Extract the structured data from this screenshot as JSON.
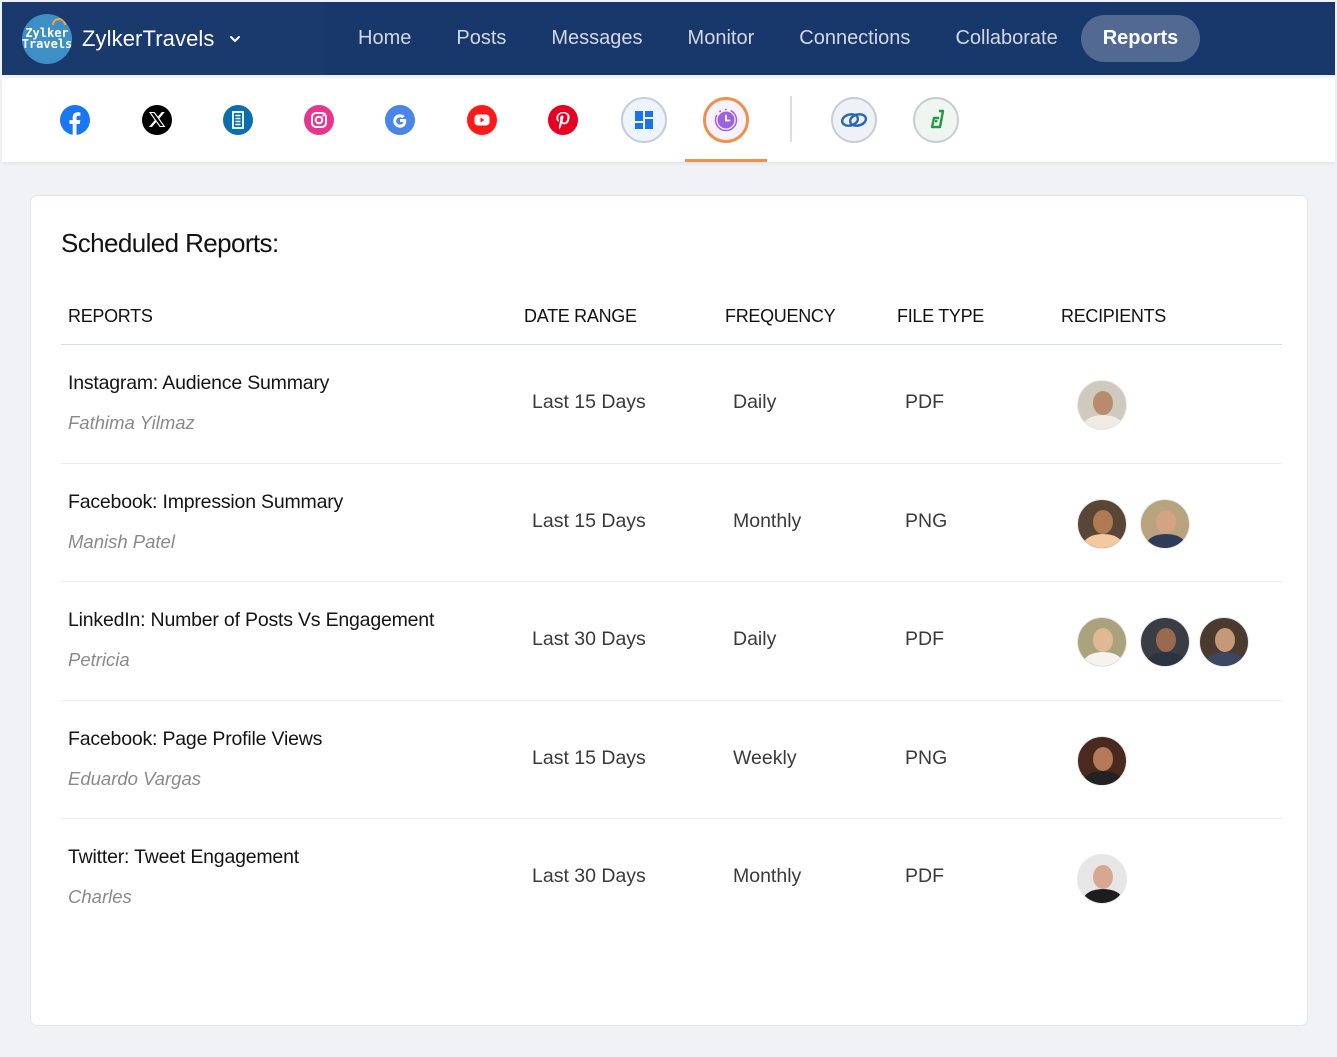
{
  "brand": {
    "name": "ZylkerTravels",
    "logo_text": [
      "Zylker",
      "Travels"
    ]
  },
  "nav": {
    "items": [
      {
        "label": "Home",
        "active": false
      },
      {
        "label": "Posts",
        "active": false
      },
      {
        "label": "Messages",
        "active": false
      },
      {
        "label": "Monitor",
        "active": false
      },
      {
        "label": "Connections",
        "active": false
      },
      {
        "label": "Collaborate",
        "active": false
      },
      {
        "label": "Reports",
        "active": true
      }
    ]
  },
  "channels": [
    {
      "icon": "facebook-icon",
      "color": "#1877f2"
    },
    {
      "icon": "x-twitter-icon",
      "color": "#000000"
    },
    {
      "icon": "google-business-icon",
      "color": "#0b6fad"
    },
    {
      "icon": "instagram-icon",
      "color": "#e1306c"
    },
    {
      "icon": "google-icon",
      "color": "#4a86e8"
    },
    {
      "icon": "youtube-icon",
      "color": "#ff0000"
    },
    {
      "icon": "pinterest-icon",
      "color": "#e60023"
    },
    {
      "icon": "dashboard-grid-icon",
      "color": "#1a73e8"
    },
    {
      "icon": "scheduled-clock-icon",
      "color": "#9c5ce0",
      "active": true
    },
    {
      "icon": "zoho-crm-icon",
      "color": "#2866b3"
    },
    {
      "icon": "zoho-desk-icon",
      "color": "#1e9b43"
    }
  ],
  "card": {
    "title": "Scheduled Reports:",
    "columns": [
      "REPORTS",
      "DATE RANGE",
      "FREQUENCY",
      "FILE TYPE",
      "RECIPIENTS"
    ],
    "rows": [
      {
        "title": "Instagram: Audience Summary",
        "owner": "Fathima Yilmaz",
        "date_range": "Last 15 Days",
        "frequency": "Daily",
        "file_type": "PDF",
        "recipients": 1
      },
      {
        "title": "Facebook: Impression Summary",
        "owner": "Manish Patel",
        "date_range": "Last 15 Days",
        "frequency": "Monthly",
        "file_type": "PNG",
        "recipients": 2
      },
      {
        "title": "LinkedIn: Number of Posts Vs Engagement",
        "owner": "Petricia",
        "date_range": "Last 30 Days",
        "frequency": "Daily",
        "file_type": "PDF",
        "recipients": 3
      },
      {
        "title": "Facebook: Page Profile Views",
        "owner": "Eduardo Vargas",
        "date_range": "Last 15 Days",
        "frequency": "Weekly",
        "file_type": "PNG",
        "recipients": 1
      },
      {
        "title": "Twitter: Tweet Engagement",
        "owner": "Charles",
        "date_range": "Last 30 Days",
        "frequency": "Monthly",
        "file_type": "PDF",
        "recipients": 1
      }
    ]
  }
}
